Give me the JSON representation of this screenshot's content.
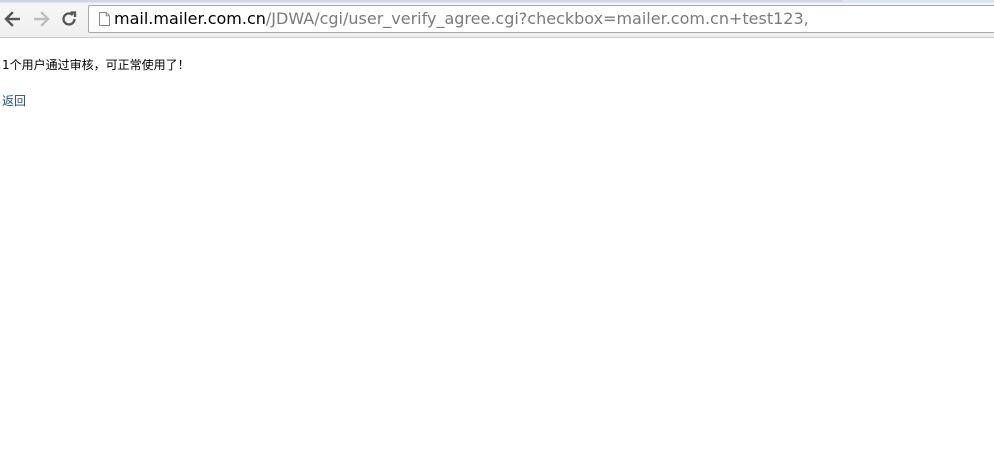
{
  "browser": {
    "back_icon": "back-arrow-icon",
    "forward_icon": "forward-arrow-icon",
    "reload_icon": "reload-icon",
    "page_icon": "page-icon",
    "url_host": "mail.mailer.com.cn",
    "url_path": "/JDWA/cgi/user_verify_agree.cgi?checkbox=mailer.com.cn+test123,",
    "colors": {
      "host_text": "#000000",
      "path_text": "#7a7a7a",
      "disabled_icon": "#bdbdbd",
      "active_icon": "#555555"
    }
  },
  "page": {
    "message": "1个用户通过审核，可正常使用了！",
    "back_link": "返回",
    "link_color": "#1a4f7a"
  }
}
